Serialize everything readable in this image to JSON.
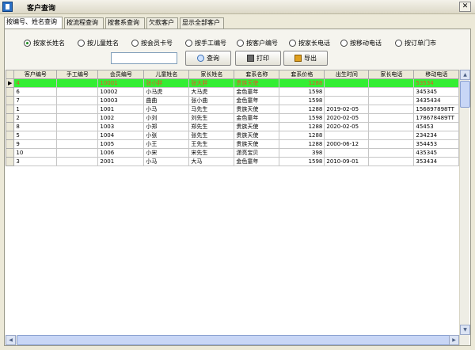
{
  "window": {
    "title": "客户查询",
    "close_label": "✕"
  },
  "tabs": [
    {
      "label": "按编号、姓名查询"
    },
    {
      "label": "按流程查询"
    },
    {
      "label": "按套系查询"
    },
    {
      "label": "欠款客户"
    },
    {
      "label": "显示全部客户"
    }
  ],
  "search_options": [
    {
      "label": "按家长姓名",
      "checked": true
    },
    {
      "label": "按儿童姓名",
      "checked": false
    },
    {
      "label": "按会员卡号",
      "checked": false
    },
    {
      "label": "按手工编号",
      "checked": false
    },
    {
      "label": "按客户编号",
      "checked": false
    },
    {
      "label": "按家长电话",
      "checked": false
    },
    {
      "label": "按移动电话",
      "checked": false
    },
    {
      "label": "按订单门市",
      "checked": false
    }
  ],
  "search": {
    "value": ""
  },
  "buttons": {
    "query": "查询",
    "print": "打印",
    "export": "导出"
  },
  "table": {
    "columns": [
      "客户编号",
      "手工编号",
      "会员编号",
      "儿童姓名",
      "家长姓名",
      "套系名称",
      "套系价格",
      "出生时间",
      "家长电话",
      "移动电话"
    ],
    "rows": [
      {
        "indicator": "▶",
        "cells": [
          "4",
          "",
          "10001",
          "张小胖",
          "张大胖",
          "贵族天使",
          "1288",
          "",
          "",
          "53534"
        ]
      },
      {
        "indicator": "",
        "cells": [
          "6",
          "",
          "10002",
          "小马虎",
          "大马虎",
          "金色童年",
          "1598",
          "",
          "",
          "345345"
        ]
      },
      {
        "indicator": "",
        "cells": [
          "7",
          "",
          "10003",
          "曲曲",
          "张小曲",
          "金色童年",
          "1598",
          "",
          "",
          "3435434"
        ]
      },
      {
        "indicator": "",
        "cells": [
          "1",
          "",
          "1001",
          "小马",
          "马先生",
          "贵族天使",
          "1288",
          "2019-02-05",
          "",
          "156897898TT"
        ]
      },
      {
        "indicator": "",
        "cells": [
          "2",
          "",
          "1002",
          "小刘",
          "刘先生",
          "金色童年",
          "1598",
          "2020-02-05",
          "",
          "178678489TT"
        ]
      },
      {
        "indicator": "",
        "cells": [
          "8",
          "",
          "1003",
          "小郑",
          "郑先生",
          "贵族天使",
          "1288",
          "2020-02-05",
          "",
          "45453"
        ]
      },
      {
        "indicator": "",
        "cells": [
          "5",
          "",
          "1004",
          "小张",
          "张先生",
          "贵族天使",
          "1288",
          "",
          "",
          "234234"
        ]
      },
      {
        "indicator": "",
        "cells": [
          "9",
          "",
          "1005",
          "小王",
          "王先生",
          "贵族天使",
          "1288",
          "2000-06-12",
          "",
          "354453"
        ]
      },
      {
        "indicator": "",
        "cells": [
          "10",
          "",
          "1006",
          "小宋",
          "宋先生",
          "潇亮宝贝",
          "398",
          "",
          "",
          "435345"
        ]
      },
      {
        "indicator": "",
        "cells": [
          "3",
          "",
          "2001",
          "小马",
          "大马",
          "金色童年",
          "1598",
          "2010-09-01",
          "",
          "353434"
        ]
      }
    ]
  },
  "scrollbar": {
    "up": "▲",
    "down": "▼",
    "left": "◀",
    "right": "▶"
  },
  "colors": {
    "selected_row_bg": "#33ee33",
    "selected_row_text": "#e05a2a"
  }
}
